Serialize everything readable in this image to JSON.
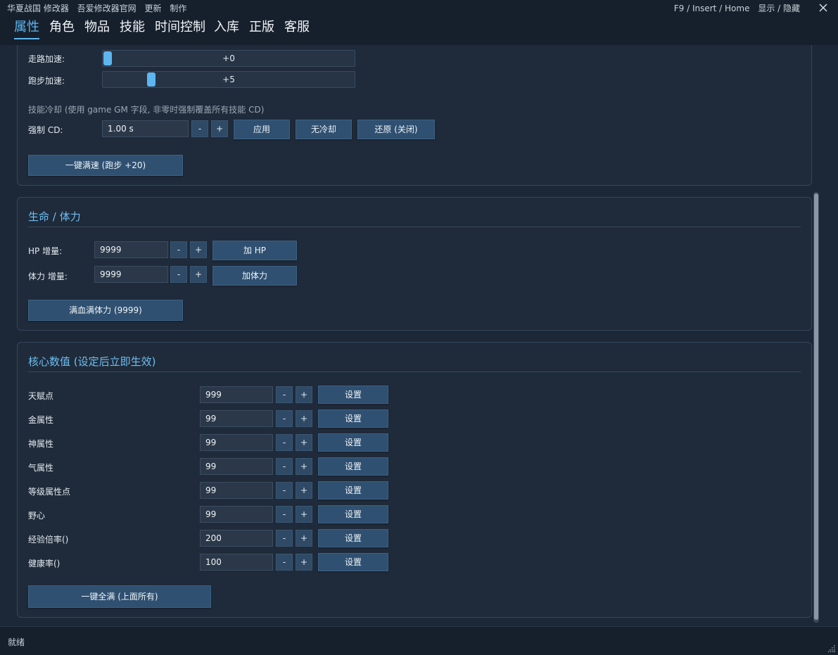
{
  "titlebar": {
    "menu": [
      "华夏战国 修改器",
      "吾爱修改器官网",
      "更新",
      "制作"
    ],
    "hotkeys": "F9 / Insert / Home",
    "toggle": "显示 / 隐藏"
  },
  "tabs": [
    {
      "label": "属性",
      "active": true
    },
    {
      "label": "角色"
    },
    {
      "label": "物品"
    },
    {
      "label": "技能"
    },
    {
      "label": "时间控制"
    },
    {
      "label": "入库"
    },
    {
      "label": "正版"
    },
    {
      "label": "客服"
    }
  ],
  "speed": {
    "walk_label": "走路加速:",
    "walk_value": "+0",
    "walk_level": 0,
    "run_label": "跑步加速:",
    "run_value": "+5",
    "run_level": 0.18,
    "cd_hint": "技能冷却 (使用 game GM 字段, 非零时强制覆盖所有技能 CD)",
    "cd_label": "强制 CD:",
    "cd_value": "1.00 s",
    "minus": "-",
    "plus": "+",
    "apply": "应用",
    "no_cd": "无冷却",
    "restore": "还原 (关闭)",
    "max_speed": "一键满速 (跑步 +20)"
  },
  "life": {
    "title": "生命 / 体力",
    "hp_label": "HP 增量:",
    "hp_value": "9999",
    "hp_button": "加 HP",
    "stamina_label": "体力 增量:",
    "stamina_value": "9999",
    "stamina_button": "加体力",
    "full_button": "满血满体力 (9999)",
    "minus": "-",
    "plus": "+"
  },
  "core": {
    "title": "核心数值 (设定后立即生效)",
    "rows": [
      {
        "label": "天赋点",
        "value": "999"
      },
      {
        "label": "金属性",
        "value": "99"
      },
      {
        "label": "神属性",
        "value": "99"
      },
      {
        "label": "气属性",
        "value": "99"
      },
      {
        "label": "等级属性点",
        "value": "99"
      },
      {
        "label": "野心",
        "value": "99"
      },
      {
        "label": "经验倍率()",
        "value": "200"
      },
      {
        "label": "健康率()",
        "value": "100"
      }
    ],
    "set": "设置",
    "minus": "-",
    "plus": "+",
    "full_button": "一键全满 (上面所有)"
  },
  "status": "就绪"
}
